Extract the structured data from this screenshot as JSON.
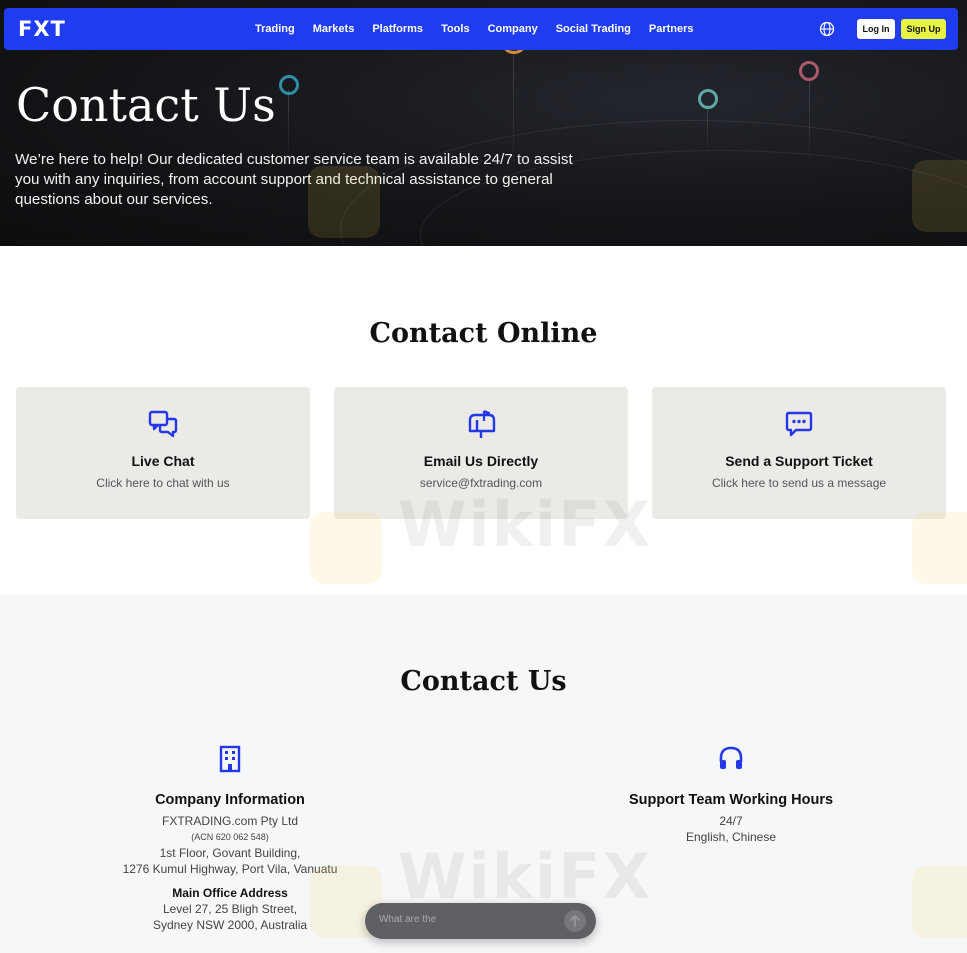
{
  "nav": {
    "logo": "FXT",
    "items": [
      "Trading",
      "Markets",
      "Platforms",
      "Tools",
      "Company",
      "Social Trading",
      "Partners"
    ],
    "login": "Log In",
    "signup": "Sign Up"
  },
  "hero": {
    "title": "Contact Us",
    "text": "We’re here to help! Our dedicated customer service team is available 24/7 to assist you with any inquiries, from account support and technical assistance to general questions about our services."
  },
  "online": {
    "title": "Contact Online",
    "cards": [
      {
        "title": "Live Chat",
        "subtitle": "Click here to chat with us",
        "icon": "chat-bubbles-icon"
      },
      {
        "title": "Email Us Directly",
        "subtitle": "service@fxtrading.com",
        "icon": "mailbox-icon"
      },
      {
        "title": "Send a Support Ticket",
        "subtitle": "Click here to send us a message",
        "icon": "message-icon"
      }
    ]
  },
  "contact": {
    "title": "Contact Us",
    "company": {
      "heading": "Company Information",
      "name": "FXTRADING.com Pty Ltd",
      "acn": "(ACN 620 062 548)",
      "address1": "1st Floor, Govant Building,",
      "address2": "1276 Kumul Highway, Port Vila, Vanuatu",
      "office_heading": "Main Office Address",
      "office1": "Level 27, 25 Bligh Street,",
      "office2": "Sydney NSW 2000, Australia"
    },
    "support": {
      "heading": "Support Team Working Hours",
      "hours": "24/7",
      "languages": "English, Chinese"
    }
  },
  "chat": {
    "placeholder": "What are the"
  },
  "watermark": "WikiFX",
  "colors": {
    "brand": "#1f3cf0",
    "signup": "#e6f542",
    "icon_blue": "#2438e8"
  }
}
